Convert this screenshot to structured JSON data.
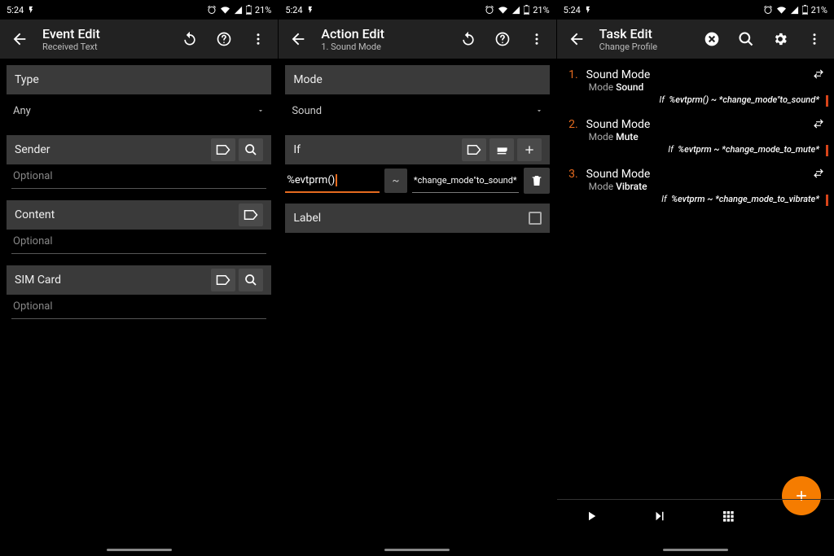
{
  "statusbar": {
    "time": "5:24",
    "battery": "21%"
  },
  "screen1": {
    "header": {
      "title": "Event Edit",
      "subtitle": "Received Text"
    },
    "type_label": "Type",
    "type_value": "Any",
    "sender_label": "Sender",
    "sender_placeholder": "Optional",
    "content_label": "Content",
    "content_placeholder": "Optional",
    "sim_label": "SIM Card",
    "sim_placeholder": "Optional"
  },
  "screen2": {
    "header": {
      "title": "Action Edit",
      "subtitle": "1. Sound Mode"
    },
    "mode_label": "Mode",
    "mode_value": "Sound",
    "if_label": "If",
    "if_lhs": "%evtprm()",
    "if_op": "~",
    "if_rhs": "*change_mode\"to_sound*",
    "label_label": "Label"
  },
  "screen3": {
    "header": {
      "title": "Task Edit",
      "subtitle": "Change Profile"
    },
    "items": [
      {
        "num": "1.",
        "name": "Sound Mode",
        "modelabel": "Mode",
        "modeval": "Sound",
        "if": "If",
        "cond": "%evtprm() ~ *change_mode\"to_sound*"
      },
      {
        "num": "2.",
        "name": "Sound Mode",
        "modelabel": "Mode",
        "modeval": "Mute",
        "if": "If",
        "cond": "%evtprm ~ *change_mode_to_mute*"
      },
      {
        "num": "3.",
        "name": "Sound Mode",
        "modelabel": "Mode",
        "modeval": "Vibrate",
        "if": "If",
        "cond": "%evtprm ~ *change_mode_to_vibrate*"
      }
    ]
  }
}
